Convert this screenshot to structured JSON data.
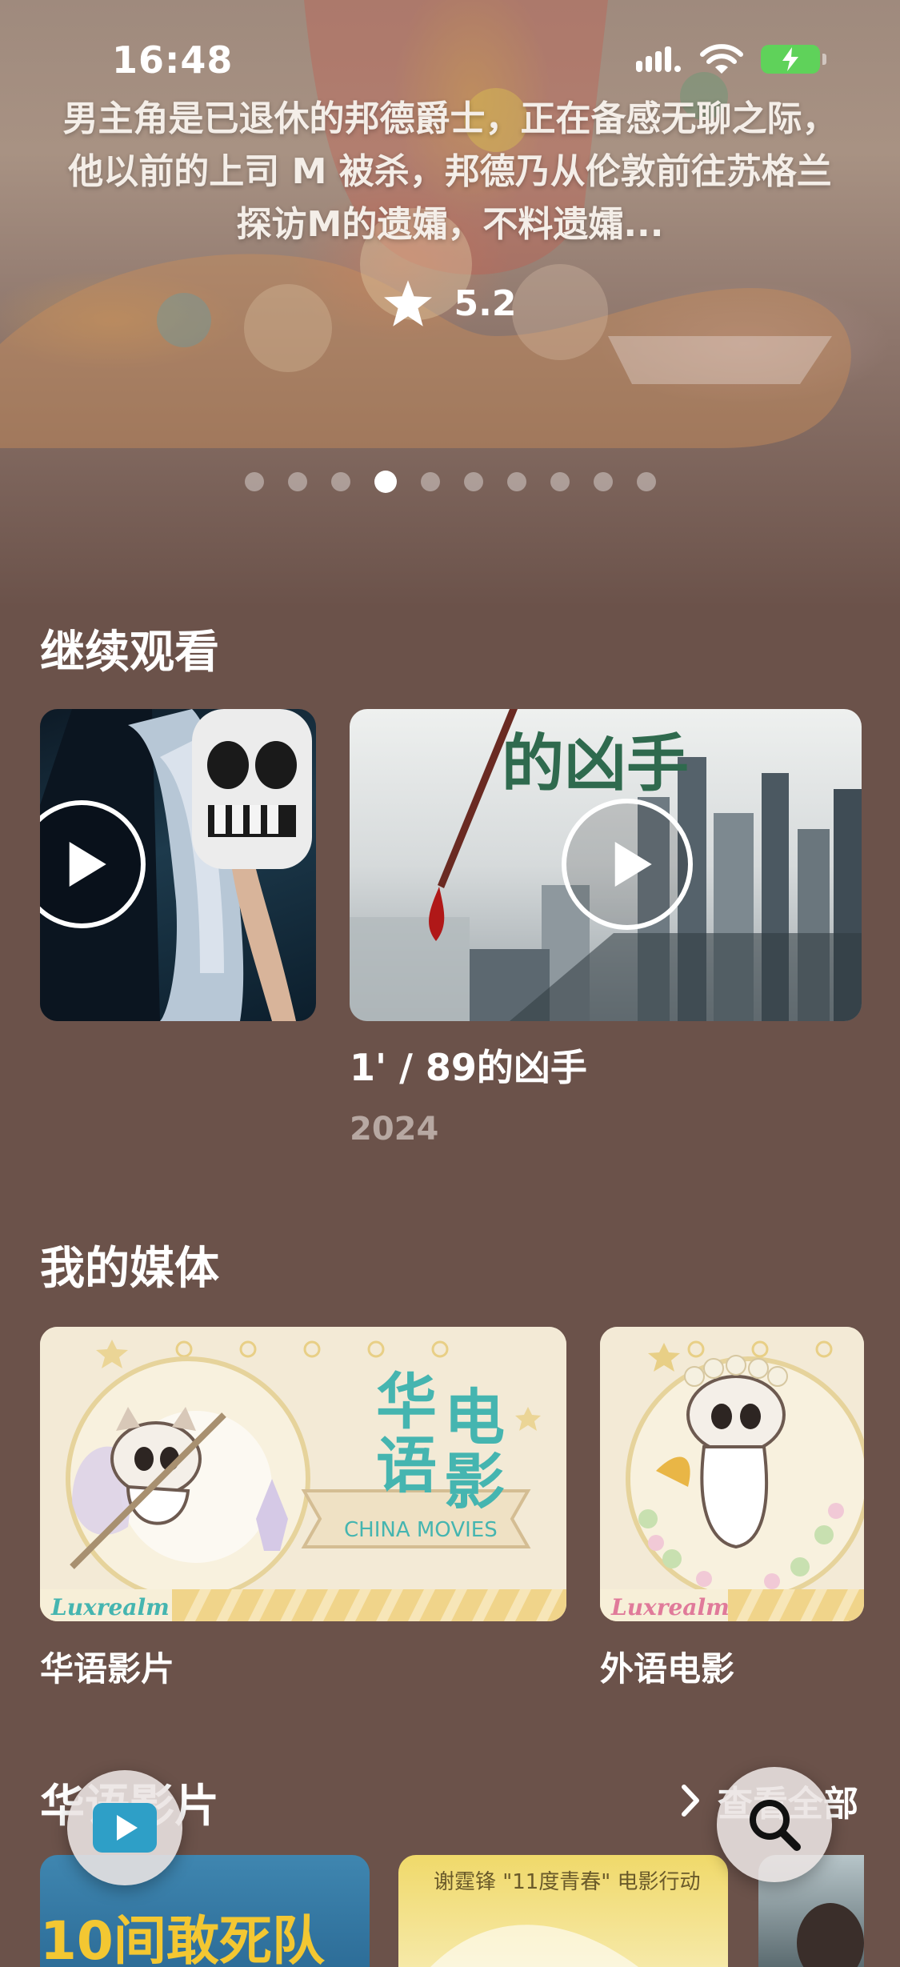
{
  "status_bar": {
    "time": "16:48"
  },
  "hero": {
    "description": "男主角是已退休的邦德爵士，正在备感无聊之际，他以前的上司 M 被杀，邦德乃从伦敦前往苏格兰探访M的遗孀，不料遗孀...",
    "rating": "5.2",
    "page_count": 10,
    "active_page": 4
  },
  "continue_watching": {
    "title": "继续观看",
    "items": [
      {
        "title": "1' / 89的凶手",
        "year": "2024",
        "poster_text": "的凶手"
      }
    ]
  },
  "my_media": {
    "title": "我的媒体",
    "items": [
      {
        "label": "华语影片",
        "art_title": "华语电影",
        "art_chars": [
          "华",
          "电",
          "语",
          "影"
        ],
        "art_banner": "CHINA MOVIES",
        "brand": "Luxrealm"
      },
      {
        "label": "外语电影",
        "brand": "Luxrealm"
      }
    ]
  },
  "chinese_films": {
    "title": "华语影片",
    "see_all": "查看全部",
    "poster_texts": [
      "10间敢死队",
      "谢霆锋 \"11度青春\" 电影行动"
    ]
  },
  "colors": {
    "background": "#6b524a",
    "battery": "#5fd25a",
    "play_icon": "#2e9fc7",
    "media_teal": "#45b5b0"
  },
  "icons": {
    "play_fab": "play-square-icon",
    "search_fab": "search-icon"
  }
}
